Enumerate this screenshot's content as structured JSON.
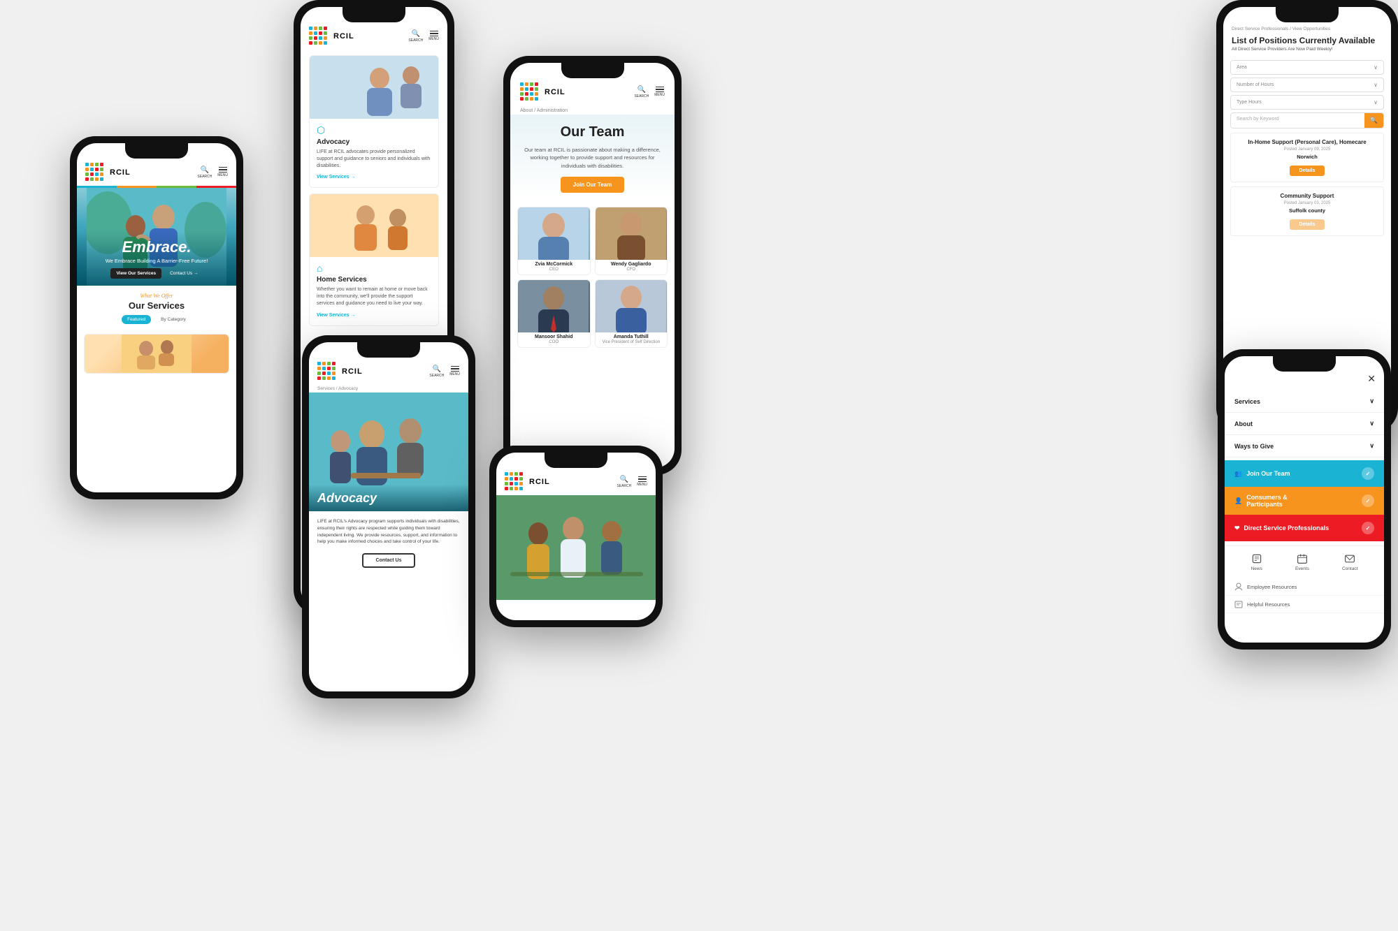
{
  "brand": {
    "name": "RCIL",
    "logo_alt": "RCIL logo with colorful grid"
  },
  "phone1": {
    "header": {
      "search_label": "SEARCH",
      "menu_label": "MENU"
    },
    "hero": {
      "title": "Embrace.",
      "subtitle": "We Embrace Building A Barrier-Free Future!",
      "btn1": "View Our Services",
      "btn2": "Contact Us →"
    },
    "services": {
      "label": "What We Offer",
      "title": "Our Services",
      "tab1": "Featured",
      "tab2": "By Category"
    }
  },
  "phone2": {
    "header": {
      "search_label": "SEARCH",
      "menu_label": "MENU"
    },
    "card1": {
      "title": "Advocacy",
      "text": "LIFE at RCIL advocates provide personalized support and guidance to seniors and individuals with disabilities.",
      "link": "View Services →"
    },
    "card2": {
      "title": "Home Services",
      "text": "Whether you want to remain at home or move back into the community, we'll provide the support services and guidance you need to live your way.",
      "link": "View Services →"
    }
  },
  "phone3": {
    "breadcrumb": "About / Administration",
    "title": "Our Team",
    "desc": "Our team at RCIL is passionate about making a difference, working together to provide support and resources for individuals with disabilities.",
    "join_btn": "Join Our Team",
    "team": [
      {
        "name": "Zvia McCormick",
        "role": "CEO"
      },
      {
        "name": "Wendy Gagliardo",
        "role": "CFO"
      },
      {
        "name": "Mansoor Shahid",
        "role": "COO"
      },
      {
        "name": "Amanda Tuthill",
        "role": "Vice President of Self Direction"
      }
    ]
  },
  "phone4": {
    "header": {
      "search_label": "SEARCH",
      "menu_label": "MENU"
    },
    "breadcrumb": "Services / Advocacy",
    "hero_title": "Advocacy",
    "body_text": "LIFE at RCIL's Advocacy program supports individuals with disabilities, ensuring their rights are respected while guiding them toward independent living. We provide resources, support, and information to help you make informed choices and take control of your life.",
    "contact_btn": "Contact Us"
  },
  "phone5": {
    "header": {
      "search_label": "SEARCH",
      "menu_label": "MENU"
    }
  },
  "phone6": {
    "breadcrumb": "Direct Service Professionals / View Opportunities",
    "title": "List of Positions Currently Available",
    "subtitle": "All Direct Service Providers Are Now Paid Weekly!",
    "filters": {
      "area_label": "Area",
      "hours_label": "Number of Hours",
      "type_label": "Type Hours",
      "search_placeholder": "Search by Keyword"
    },
    "jobs": [
      {
        "title": "In-Home Support (Personal Care), Homecare",
        "date": "Posted January 09, 2025",
        "location": "Norwich",
        "btn": "Details"
      },
      {
        "title": "Community Support",
        "date": "Posted January 03, 2025",
        "location": "Suffolk county",
        "btn": "Details"
      }
    ]
  },
  "phone7": {
    "nav_items": [
      {
        "label": "Services",
        "has_chevron": true
      },
      {
        "label": "About",
        "has_chevron": true
      },
      {
        "label": "Ways to Give",
        "has_chevron": true
      }
    ],
    "cta_items": [
      {
        "label": "Join Our Team",
        "color": "teal",
        "icon": "👥"
      },
      {
        "label": "Consumers & Participants",
        "color": "orange",
        "icon": "👤"
      },
      {
        "label": "Direct Service Professionals",
        "color": "red",
        "icon": "❤"
      }
    ],
    "footer_icons": [
      {
        "label": "News",
        "icon": "📄"
      },
      {
        "label": "Events",
        "icon": "📅"
      },
      {
        "label": "Contact",
        "icon": "✉"
      }
    ],
    "resources": [
      {
        "label": "Employee Resources",
        "icon": "👤"
      },
      {
        "label": "Helpful Resources",
        "icon": "📋"
      }
    ]
  }
}
